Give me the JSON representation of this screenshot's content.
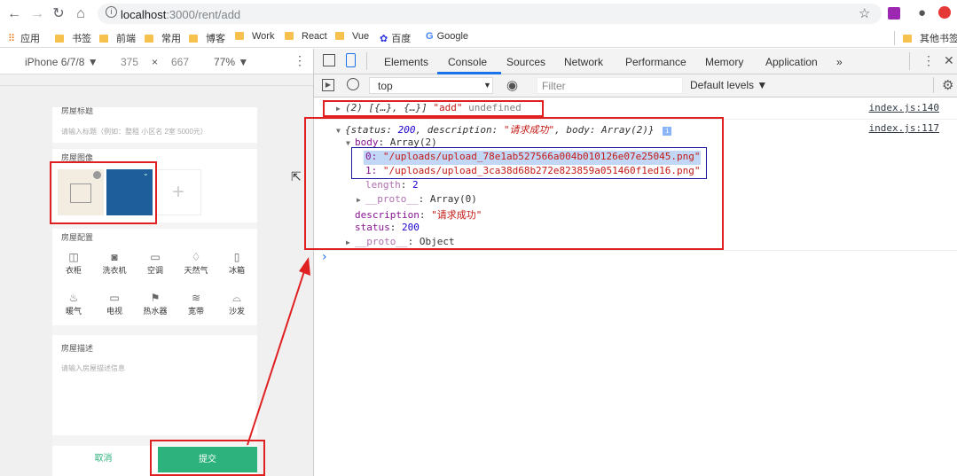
{
  "browser": {
    "url_host": "localhost",
    "url_path": ":3000/rent/add"
  },
  "bookmarks": [
    "应用",
    "书签",
    "前端",
    "常用",
    "博客",
    "Work",
    "React",
    "Vue",
    "百度",
    "Google",
    "其他书签"
  ],
  "device": {
    "model": "iPhone 6/7/8 ▼",
    "width": "375",
    "x": "×",
    "height": "667",
    "zoom": "77% ▼"
  },
  "phone": {
    "title_label": "房屋标题",
    "title_placeholder": "请输入标题（例如：整租 小区名 2室 5000元）",
    "image_label": "房屋图像",
    "config_label": "房屋配置",
    "facilities": [
      "衣柜",
      "洗衣机",
      "空调",
      "天然气",
      "冰箱",
      "暖气",
      "电视",
      "热水器",
      "宽带",
      "沙发"
    ],
    "desc_label": "房屋描述",
    "desc_placeholder": "请输入房屋描述信息",
    "cancel": "取消",
    "submit": "提交"
  },
  "devtools": {
    "tabs": [
      "Elements",
      "Console",
      "Sources",
      "Network",
      "Performance",
      "Memory",
      "Application",
      "»"
    ],
    "context": "top",
    "filter_placeholder": "Filter",
    "levels": "Default levels ▼"
  },
  "console": {
    "line1": "(2) [{…}, {…}]",
    "line1_b": "\"add\"",
    "line1_c": "undefined",
    "src1": "index.js:140",
    "obj_head_a": "{status: ",
    "obj_head_status": "200",
    "obj_head_b": ", description: ",
    "obj_head_desc": "\"请求成功\"",
    "obj_head_c": ", body: Array(2)}",
    "src2": "index.js:117",
    "body_key": "body",
    "body_val": "Array(2)",
    "item0_key": "0:",
    "item0_val": "\"/uploads/upload_78e1ab527566a004b010126e07e25045.png\"",
    "item1_key": "1:",
    "item1_val": "\"/uploads/upload_3ca38d68b272e823859a051460f1ed16.png\"",
    "length_key": "length",
    "length_val": "2",
    "proto_key": "__proto__",
    "proto_val": "Array(0)",
    "desc_key": "description",
    "desc_val": "\"请求成功\"",
    "status_key": "status",
    "status_val": "200",
    "proto2_key": "__proto__",
    "proto2_val": "Object",
    "prompt": "›"
  },
  "colors": {
    "accent_green": "#2db27d",
    "annot_red": "#e02020",
    "annot_blue": "#1a1aa0"
  }
}
